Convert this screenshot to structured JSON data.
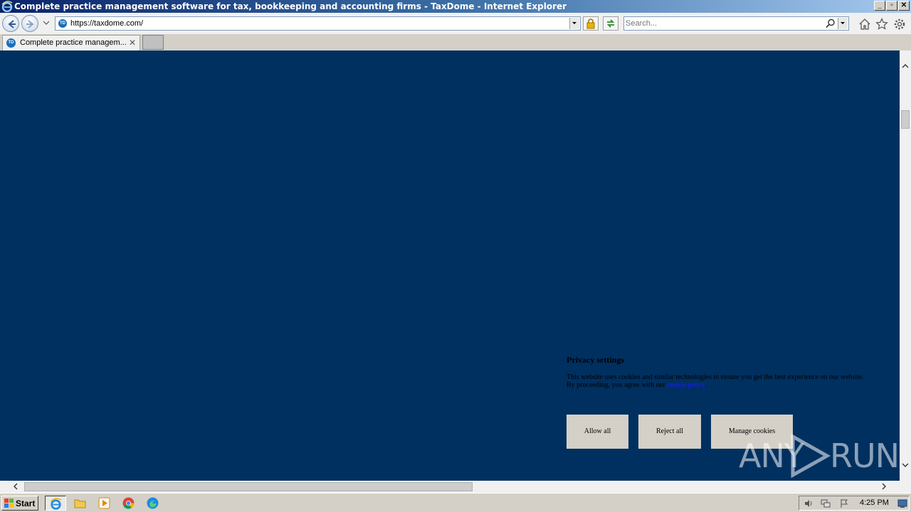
{
  "window": {
    "title": "Complete practice management software for tax, bookkeeping and accounting firms - TaxDome - Internet Explorer"
  },
  "address_bar": {
    "url": "https://taxdome.com/",
    "favicon_text": "TD"
  },
  "search": {
    "placeholder": "Search..."
  },
  "tabs": [
    {
      "label": "Complete practice managem...",
      "favicon_text": "TD"
    }
  ],
  "privacy": {
    "title": "Privacy settings",
    "text_before_link": "This website uses cookies and similar technologies to ensure you get the best experience on our website. By proceeding, you agree with our ",
    "link_text": "cookie policy",
    "text_after_link": ".",
    "buttons": {
      "allow": "Allow all",
      "reject": "Reject all",
      "manage": "Manage cookies"
    }
  },
  "watermark": {
    "left": "ANY",
    "right": "RUN"
  },
  "taskbar": {
    "start_label": "Start",
    "clock": "4:25 PM"
  },
  "colors": {
    "page_background": "#003060",
    "button_background": "#d4d0c8",
    "link": "#1a1aff"
  }
}
